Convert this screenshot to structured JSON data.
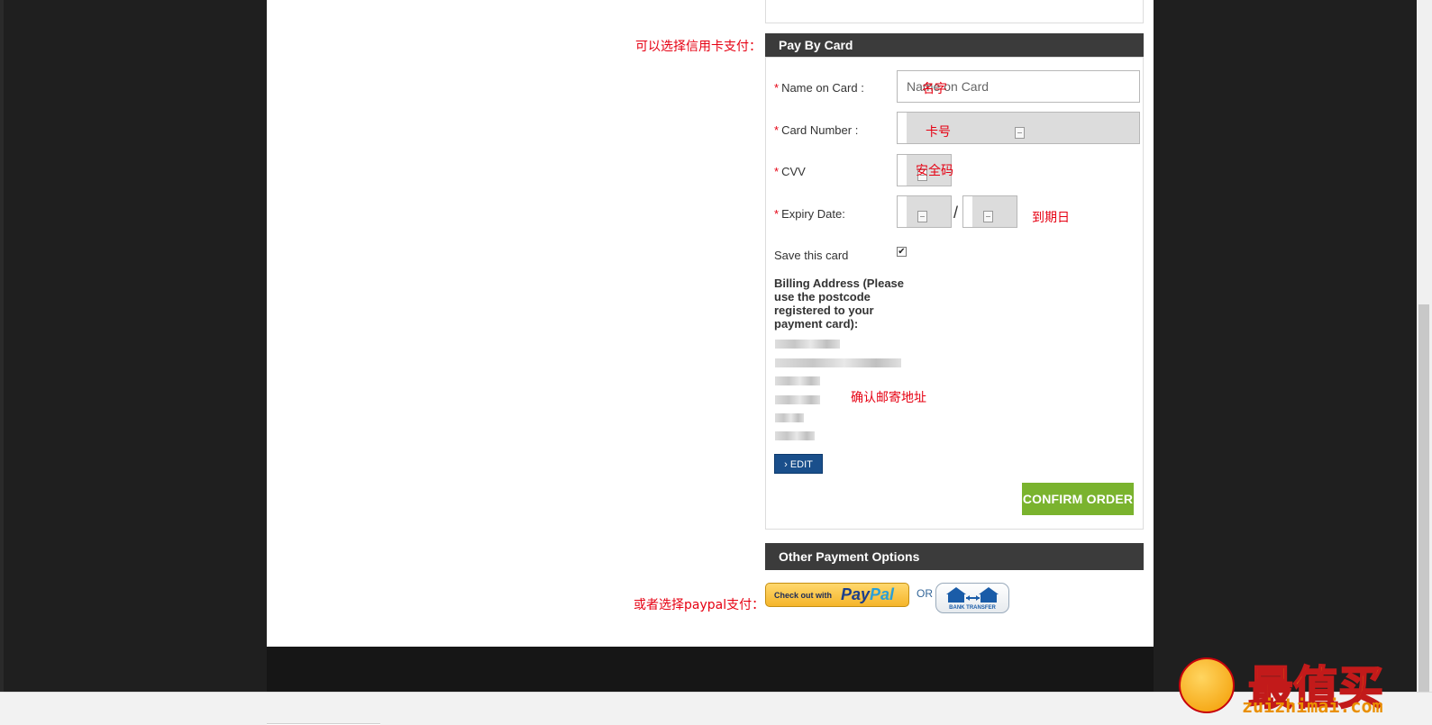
{
  "annotations": {
    "pay_by_card_hint": "可以选择信用卡支付：",
    "name_hint": "名字",
    "card_number_hint": "卡号",
    "cvv_hint": "安全码",
    "expiry_hint": "到期日",
    "address_hint": "确认邮寄地址",
    "paypal_hint": "或者选择paypal支付："
  },
  "pay_by_card": {
    "header": "Pay By Card",
    "required_mark": "*",
    "name_label": "Name on Card :",
    "name_placeholder": "Name on Card",
    "card_number_label": "Card Number :",
    "cvv_label": "CVV",
    "expiry_label": "Expiry Date:",
    "expiry_separator": "/",
    "save_card_label": "Save this card",
    "save_card_checked": true,
    "billing_title": "Billing Address (Please use the postcode registered to your payment card):",
    "edit_label": "› EDIT",
    "confirm_label": "CONFIRM ORDER"
  },
  "other_payment": {
    "header": "Other Payment Options",
    "paypal_small": "Check out with",
    "paypal_pay": "Pay",
    "paypal_pal": "Pal",
    "or_label": "OR",
    "bank_caption": "BANK TRANSFER"
  },
  "watermark": {
    "brand": "最值买",
    "url": "zuizhimai.com"
  },
  "colors": {
    "header_bg": "#3b3b3b",
    "annotation_red": "#e60012",
    "confirm_green": "#7ab32e",
    "edit_blue": "#1a4f8b"
  }
}
